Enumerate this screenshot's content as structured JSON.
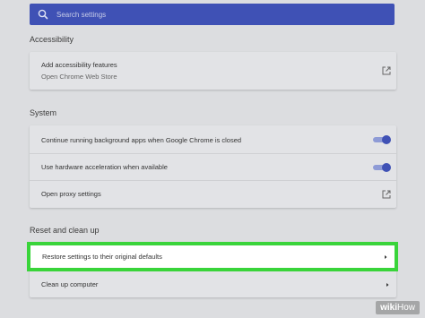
{
  "search": {
    "placeholder": "Search settings"
  },
  "sections": {
    "accessibility": {
      "title": "Accessibility",
      "items": [
        {
          "label": "Add accessibility features",
          "sublabel": "Open Chrome Web Store",
          "icon": "external-link-icon"
        }
      ]
    },
    "system": {
      "title": "System",
      "items": [
        {
          "label": "Continue running background apps when Google Chrome is closed",
          "toggle": true
        },
        {
          "label": "Use hardware acceleration when available",
          "toggle": true
        },
        {
          "label": "Open proxy settings",
          "icon": "external-link-icon"
        }
      ]
    },
    "reset": {
      "title": "Reset and clean up",
      "items": [
        {
          "label": "Restore settings to their original defaults",
          "icon": "chevron-right-icon"
        },
        {
          "label": "Clean up computer",
          "icon": "chevron-right-icon"
        }
      ]
    }
  },
  "colors": {
    "accent": "#3f51b5",
    "highlight": "#39d43a",
    "background": "#dcdde0"
  },
  "watermark": {
    "brand": "wiki",
    "suffix": "How"
  }
}
